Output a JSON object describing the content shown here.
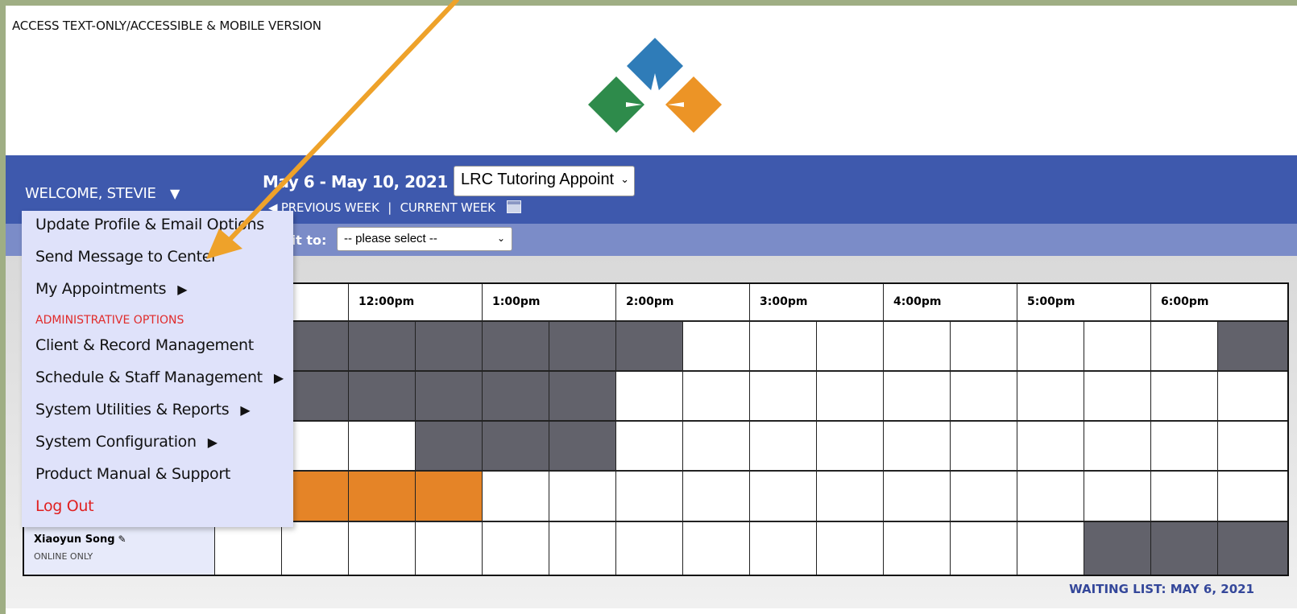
{
  "header": {
    "access_link": "ACCESS TEXT-ONLY/ACCESSIBLE & MOBILE VERSION",
    "logo_icon": "four-diamond-logo-icon"
  },
  "nav": {
    "welcome": "WELCOME, STEVIE",
    "date_range": "May 6 - May 10, 2021",
    "schedule_selected": "LRC Tutoring Appoint",
    "previous_week": "◀ PREVIOUS WEEK",
    "separator": "|",
    "current_week": "CURRENT WEEK",
    "limit_label": "mit to:",
    "limit_selected": "-- please select --"
  },
  "menu": {
    "items": [
      {
        "label": "Update Profile & Email Options"
      },
      {
        "label": "Send Message to Center"
      },
      {
        "label": "My Appointments",
        "arrow": "▶"
      },
      {
        "label": "Client & Record Management"
      },
      {
        "label": "Schedule & Staff Management",
        "arrow": "▶"
      },
      {
        "label": "System Utilities & Reports",
        "arrow": "▶"
      },
      {
        "label": "System Configuration",
        "arrow": "▶"
      },
      {
        "label": "Product Manual & Support"
      },
      {
        "label": "Log Out"
      }
    ],
    "section_label": "ADMINISTRATIVE OPTIONS"
  },
  "grid": {
    "times": [
      "12:00pm",
      "1:00pm",
      "2:00pm",
      "3:00pm",
      "4:00pm",
      "5:00pm",
      "6:00pm"
    ],
    "last_provider": {
      "name": "Xiaoyun Song",
      "mode": "ONLINE ONLY"
    }
  },
  "footer": {
    "waiting_list": "WAITING LIST: MAY 6, 2021"
  },
  "colors": {
    "topbar": "#3e59ad",
    "subbar": "#7b8cc8",
    "shaded_slot": "#62626b",
    "booked_slot": "#e58427",
    "menu_bg": "#dfe2fa",
    "logout": "#e02020",
    "arrow": "#eea22a"
  }
}
